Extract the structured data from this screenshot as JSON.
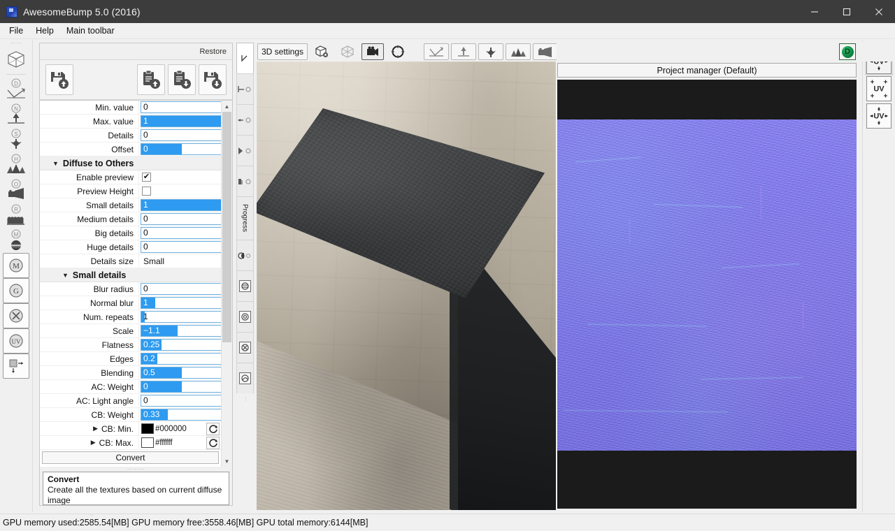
{
  "window": {
    "title": "AwesomeBump 5.0 (2016)",
    "icon": "app-icon",
    "controls": {
      "minimize": "—",
      "maximize": "☐",
      "close": "✕"
    }
  },
  "menubar": {
    "items": [
      "File",
      "Help",
      "Main toolbar"
    ]
  },
  "left_toolbar": {
    "items": [
      {
        "name": "cube-wireframe-icon",
        "glyph": "cube"
      },
      {
        "name": "diffuse-image-icon",
        "glyph": "diffuse",
        "badge": "D"
      },
      {
        "name": "normal-image-icon",
        "glyph": "normal",
        "badge": "N"
      },
      {
        "name": "specular-image-icon",
        "glyph": "specular",
        "badge": "S"
      },
      {
        "name": "height-image-icon",
        "glyph": "height",
        "badge": "H"
      },
      {
        "name": "occlusion-image-icon",
        "glyph": "occlusion",
        "badge": "O"
      },
      {
        "name": "roughness-image-icon",
        "glyph": "roughness",
        "badge": "R"
      },
      {
        "name": "metallic-image-icon",
        "glyph": "metallic",
        "badge": "M"
      },
      {
        "name": "material-icon",
        "badge": "M"
      },
      {
        "name": "grunge-icon",
        "badge": "G"
      },
      {
        "name": "settings-tools-icon",
        "badge": "tools"
      },
      {
        "name": "uv-icon",
        "badge": "UV"
      },
      {
        "name": "resize-icon",
        "badge": "resize"
      }
    ]
  },
  "right_toolbar": {
    "items": [
      {
        "name": "uv-pan-button",
        "label": "UV",
        "selected": true
      },
      {
        "name": "uv-corners-button",
        "label": "UV",
        "selected": false
      },
      {
        "name": "uv-center-button",
        "label": "UV",
        "selected": false
      }
    ]
  },
  "properties_dock": {
    "restore_label": "Restore",
    "toolbar_buttons": [
      {
        "name": "save-settings-button",
        "icon": "floppy-up-icon"
      },
      {
        "name": "load-clipboard-up-button",
        "icon": "clipboard-up-icon"
      },
      {
        "name": "save-clipboard-down-button",
        "icon": "clipboard-down-icon"
      },
      {
        "name": "load-settings-button",
        "icon": "floppy-down-icon"
      }
    ],
    "rows": [
      {
        "kind": "slider",
        "label": "Min. value",
        "value": "0",
        "fill_pct": 0
      },
      {
        "kind": "slider",
        "label": "Max. value",
        "value": "1",
        "fill_pct": 100
      },
      {
        "kind": "slider",
        "label": "Details",
        "value": "0",
        "fill_pct": 0
      },
      {
        "kind": "slider",
        "label": "Offset",
        "value": "0",
        "fill_pct": 50
      },
      {
        "kind": "group",
        "label": "Diffuse to Others",
        "indent": 0,
        "expanded": true
      },
      {
        "kind": "checkbox",
        "label": "Enable preview",
        "checked": true
      },
      {
        "kind": "checkbox",
        "label": "Preview Height",
        "checked": false
      },
      {
        "kind": "slider",
        "label": "Small details",
        "value": "1",
        "fill_pct": 100
      },
      {
        "kind": "slider",
        "label": "Medium details",
        "value": "0",
        "fill_pct": 0
      },
      {
        "kind": "slider",
        "label": "Big details",
        "value": "0",
        "fill_pct": 0
      },
      {
        "kind": "slider",
        "label": "Huge details",
        "value": "0",
        "fill_pct": 0
      },
      {
        "kind": "text",
        "label": "Details size",
        "value": "Small"
      },
      {
        "kind": "group",
        "label": "Small details",
        "indent": 1,
        "expanded": true
      },
      {
        "kind": "slider",
        "label": "Blur radius",
        "value": "0",
        "fill_pct": 0
      },
      {
        "kind": "slider",
        "label": "Normal blur",
        "value": "1",
        "fill_pct": 17
      },
      {
        "kind": "slider",
        "label": "Num. repeats",
        "value": "1",
        "fill_pct": 4
      },
      {
        "kind": "slider",
        "label": "Scale",
        "value": "−1.1",
        "fill_pct": 45
      },
      {
        "kind": "slider",
        "label": "Flatness",
        "value": "0.25",
        "fill_pct": 25
      },
      {
        "kind": "slider",
        "label": "Edges",
        "value": "0.2",
        "fill_pct": 20
      },
      {
        "kind": "slider",
        "label": "Blending",
        "value": "0.5",
        "fill_pct": 50
      },
      {
        "kind": "slider",
        "label": "AC: Weight",
        "value": "0",
        "fill_pct": 50
      },
      {
        "kind": "slider",
        "label": "AC: Light angle",
        "value": "0",
        "fill_pct": 0
      },
      {
        "kind": "slider",
        "label": "CB: Weight",
        "value": "0.33",
        "fill_pct": 33
      },
      {
        "kind": "color",
        "label": "CB: Min.",
        "value": "#000000",
        "swatch": "#000000"
      },
      {
        "kind": "color",
        "label": "CB: Max.",
        "value": "#ffffff",
        "swatch": "#ffffff"
      }
    ],
    "convert_label": "Convert",
    "hint": {
      "title": "Convert",
      "body": "Create all the textures based on current diffuse image"
    },
    "slider_fill_color": "#2e9bf0"
  },
  "vertical_tabs": {
    "items": [
      {
        "name": "tab-cursor",
        "label": "",
        "active": true
      },
      {
        "name": "tab-diffuse-to-others",
        "label": ""
      },
      {
        "name": "tab-normal-to-others",
        "label": ""
      },
      {
        "name": "tab-height-to-others",
        "label": ""
      },
      {
        "name": "tab-occlusion-to-others",
        "label": ""
      },
      {
        "name": "tab-progress",
        "label": "Progress"
      },
      {
        "name": "tab-contrast",
        "label": ""
      },
      {
        "name": "tab-seamless-a",
        "label": ""
      },
      {
        "name": "tab-seamless-b",
        "label": ""
      },
      {
        "name": "tab-seamless-c",
        "label": ""
      },
      {
        "name": "tab-seamless-d",
        "label": ""
      }
    ]
  },
  "viewport": {
    "toolbar": {
      "settings_label": "3D settings",
      "buttons": [
        {
          "name": "mesh-settings-icon",
          "pressed": false
        },
        {
          "name": "wireframe-cube-icon",
          "pressed": false
        },
        {
          "name": "camera-icon",
          "pressed": true
        },
        {
          "name": "target-crosshair-icon",
          "pressed": false
        },
        {
          "name": "diffuse-map-icon",
          "pressed": false
        },
        {
          "name": "normal-map-icon",
          "pressed": false
        },
        {
          "name": "specular-map-icon",
          "pressed": false
        },
        {
          "name": "height-map-icon",
          "pressed": false
        },
        {
          "name": "occlusion-map-icon",
          "pressed": false
        },
        {
          "name": "roughness-map-icon",
          "pressed": false
        },
        {
          "name": "metallic-map-icon",
          "pressed": false
        }
      ]
    }
  },
  "project_manager": {
    "button_label": "Project manager (Default)",
    "status_badge": "D",
    "status_color": "#0f8a42"
  },
  "statusbar": {
    "text": "GPU memory used:2585.54[MB] GPU memory free:3558.46[MB] GPU total memory:6144[MB]"
  }
}
